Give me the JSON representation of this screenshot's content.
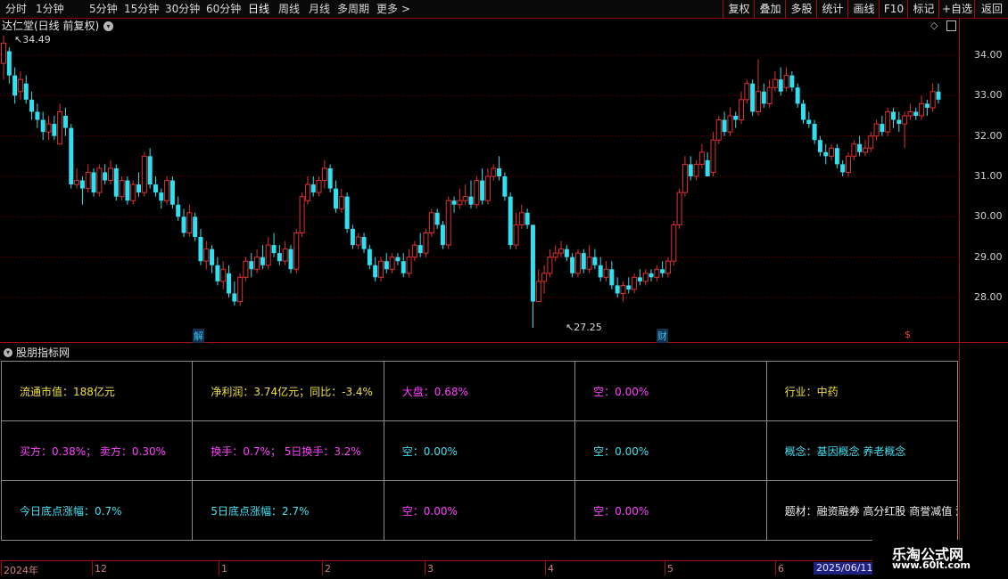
{
  "toolbar": {
    "periods": [
      "分时",
      "1分钟",
      "5分钟",
      "15分钟",
      "30分钟",
      "60分钟",
      "日线",
      "周线",
      "月线",
      "多周期",
      "更多 >"
    ],
    "right_buttons": [
      "复权",
      "叠加",
      "多股",
      "统计",
      "画线",
      "F10",
      "标记",
      "+自选",
      "返回"
    ]
  },
  "chart": {
    "title": "达仁堂(日线 前复权)",
    "high_label": "34.49",
    "low_label": "27.25",
    "markers": [
      "解",
      "财",
      "$"
    ],
    "colors": {
      "up": "#e03030",
      "down": "#30e0f0",
      "grid": "#7a0000"
    }
  },
  "chart_data": {
    "type": "candlestick",
    "y_ticks": [
      "34.00",
      "33.00",
      "32.00",
      "31.00",
      "30.00",
      "29.00",
      "28.00"
    ],
    "ylim": [
      27.2,
      34.6
    ],
    "x_ticks": [
      "2024年",
      "12",
      "1",
      "2",
      "3",
      "4",
      "5",
      "6"
    ],
    "candles": [
      [
        33.8,
        34.3,
        33.4,
        34.49
      ],
      [
        34.1,
        33.5,
        33.3,
        34.2
      ],
      [
        33.5,
        33.0,
        32.8,
        33.7
      ],
      [
        33.1,
        33.4,
        32.9,
        33.6
      ],
      [
        33.3,
        32.9,
        32.8,
        33.5
      ],
      [
        32.9,
        32.6,
        32.4,
        33.1
      ],
      [
        32.6,
        32.4,
        32.2,
        32.8
      ],
      [
        32.4,
        32.1,
        31.9,
        32.6
      ],
      [
        32.1,
        32.3,
        31.9,
        32.5
      ],
      [
        32.3,
        32.0,
        31.9,
        32.5
      ],
      [
        31.8,
        32.6,
        31.8,
        32.8
      ],
      [
        32.5,
        32.2,
        32.0,
        32.7
      ],
      [
        32.2,
        30.8,
        30.7,
        32.3
      ],
      [
        30.8,
        30.9,
        30.7,
        31.2
      ],
      [
        30.9,
        30.7,
        30.3,
        31.0
      ],
      [
        30.7,
        31.1,
        30.6,
        31.3
      ],
      [
        31.1,
        30.6,
        30.5,
        31.2
      ],
      [
        30.6,
        31.2,
        30.5,
        31.3
      ],
      [
        31.1,
        30.9,
        30.8,
        31.3
      ],
      [
        30.9,
        31.2,
        30.8,
        31.4
      ],
      [
        31.2,
        30.5,
        30.4,
        31.3
      ],
      [
        30.5,
        30.9,
        30.4,
        31.0
      ],
      [
        30.9,
        30.4,
        30.3,
        31.0
      ],
      [
        30.4,
        30.8,
        30.3,
        30.9
      ],
      [
        30.8,
        30.6,
        30.5,
        31.1
      ],
      [
        30.6,
        31.5,
        30.5,
        31.6
      ],
      [
        31.5,
        30.8,
        30.7,
        31.7
      ],
      [
        30.8,
        30.6,
        30.5,
        31.0
      ],
      [
        30.6,
        30.4,
        30.2,
        30.7
      ],
      [
        30.4,
        30.9,
        30.3,
        31.0
      ],
      [
        30.9,
        30.3,
        30.2,
        31.0
      ],
      [
        30.3,
        30.0,
        29.9,
        30.5
      ],
      [
        30.0,
        29.6,
        29.5,
        30.2
      ],
      [
        29.6,
        30.1,
        29.5,
        30.3
      ],
      [
        30.0,
        29.5,
        29.4,
        30.1
      ],
      [
        29.5,
        28.9,
        28.8,
        29.7
      ],
      [
        28.9,
        29.2,
        28.7,
        29.4
      ],
      [
        29.2,
        28.8,
        28.6,
        29.3
      ],
      [
        28.8,
        28.4,
        28.3,
        29.0
      ],
      [
        28.4,
        28.7,
        28.2,
        28.9
      ],
      [
        28.6,
        28.1,
        28.0,
        28.8
      ],
      [
        28.1,
        27.9,
        27.8,
        28.4
      ],
      [
        27.9,
        28.5,
        27.8,
        28.6
      ],
      [
        28.5,
        28.9,
        28.4,
        29.0
      ],
      [
        28.9,
        28.7,
        28.5,
        29.1
      ],
      [
        28.7,
        29.0,
        28.6,
        29.2
      ],
      [
        29.0,
        28.8,
        28.7,
        29.3
      ],
      [
        28.8,
        29.3,
        28.7,
        29.5
      ],
      [
        29.3,
        29.1,
        29.0,
        29.6
      ],
      [
        29.1,
        28.9,
        28.8,
        29.3
      ],
      [
        28.9,
        29.2,
        28.8,
        29.4
      ],
      [
        29.2,
        28.7,
        28.6,
        29.3
      ],
      [
        28.7,
        29.6,
        28.6,
        29.7
      ],
      [
        29.6,
        30.5,
        29.5,
        30.6
      ],
      [
        30.4,
        30.8,
        30.3,
        31.0
      ],
      [
        30.8,
        30.6,
        30.5,
        31.0
      ],
      [
        30.6,
        30.9,
        30.5,
        31.0
      ],
      [
        30.9,
        31.2,
        30.7,
        31.4
      ],
      [
        31.2,
        30.7,
        30.6,
        31.3
      ],
      [
        30.7,
        30.2,
        30.1,
        30.9
      ],
      [
        30.2,
        30.5,
        30.1,
        30.7
      ],
      [
        30.5,
        29.7,
        29.6,
        30.6
      ],
      [
        29.7,
        29.3,
        29.2,
        29.8
      ],
      [
        29.3,
        29.5,
        29.2,
        29.6
      ],
      [
        29.5,
        29.2,
        29.1,
        29.6
      ],
      [
        29.2,
        28.8,
        28.7,
        29.3
      ],
      [
        28.8,
        28.5,
        28.4,
        29.0
      ],
      [
        28.5,
        28.9,
        28.4,
        29.0
      ],
      [
        28.9,
        28.7,
        28.6,
        29.1
      ],
      [
        28.7,
        29.0,
        28.6,
        29.1
      ],
      [
        29.0,
        28.9,
        28.8,
        29.1
      ],
      [
        28.9,
        28.6,
        28.5,
        29.1
      ],
      [
        28.6,
        29.0,
        28.5,
        29.2
      ],
      [
        29.0,
        29.3,
        28.9,
        29.4
      ],
      [
        29.3,
        29.1,
        29.0,
        29.6
      ],
      [
        29.1,
        29.6,
        29.0,
        29.7
      ],
      [
        29.6,
        30.1,
        29.5,
        30.2
      ],
      [
        30.1,
        29.8,
        29.7,
        30.2
      ],
      [
        29.8,
        29.3,
        29.2,
        29.9
      ],
      [
        29.3,
        30.4,
        29.2,
        30.5
      ],
      [
        30.4,
        30.3,
        30.1,
        30.5
      ],
      [
        30.3,
        30.4,
        30.2,
        30.7
      ],
      [
        30.4,
        30.5,
        30.3,
        30.8
      ],
      [
        30.5,
        30.3,
        30.2,
        30.9
      ],
      [
        30.3,
        30.9,
        30.2,
        31.0
      ],
      [
        30.9,
        30.4,
        30.3,
        31.2
      ],
      [
        30.4,
        31.0,
        30.3,
        31.2
      ],
      [
        31.0,
        31.2,
        30.9,
        31.3
      ],
      [
        31.2,
        31.0,
        30.9,
        31.5
      ],
      [
        31.0,
        30.5,
        30.4,
        31.1
      ],
      [
        30.5,
        29.3,
        29.2,
        30.6
      ],
      [
        29.3,
        29.8,
        29.2,
        30.1
      ],
      [
        29.8,
        30.1,
        29.7,
        30.3
      ],
      [
        30.1,
        29.8,
        29.7,
        30.2
      ],
      [
        29.8,
        27.9,
        27.25,
        28.9
      ],
      [
        27.9,
        28.4,
        27.9,
        28.7
      ],
      [
        28.4,
        28.6,
        28.1,
        28.8
      ],
      [
        28.6,
        29.0,
        28.5,
        29.2
      ],
      [
        29.0,
        29.1,
        28.9,
        29.3
      ],
      [
        29.1,
        29.2,
        29.0,
        29.4
      ],
      [
        29.2,
        29.0,
        28.9,
        29.3
      ],
      [
        29.0,
        28.6,
        28.5,
        29.1
      ],
      [
        28.6,
        29.1,
        28.5,
        29.2
      ],
      [
        29.1,
        28.7,
        28.6,
        29.2
      ],
      [
        28.7,
        29.0,
        28.6,
        29.3
      ],
      [
        29.0,
        28.8,
        28.7,
        29.2
      ],
      [
        28.8,
        28.5,
        28.4,
        29.0
      ],
      [
        28.5,
        28.7,
        28.4,
        28.9
      ],
      [
        28.7,
        28.3,
        28.2,
        28.9
      ],
      [
        28.3,
        28.1,
        28.0,
        28.5
      ],
      [
        28.1,
        28.3,
        27.9,
        28.4
      ],
      [
        28.3,
        28.2,
        28.1,
        28.5
      ],
      [
        28.2,
        28.5,
        28.1,
        28.6
      ],
      [
        28.5,
        28.4,
        28.3,
        28.7
      ],
      [
        28.4,
        28.6,
        28.3,
        28.7
      ],
      [
        28.6,
        28.5,
        28.4,
        28.7
      ],
      [
        28.5,
        28.7,
        28.4,
        28.8
      ],
      [
        28.7,
        28.6,
        28.5,
        28.9
      ],
      [
        28.6,
        28.9,
        28.5,
        29.0
      ],
      [
        28.9,
        29.8,
        28.8,
        29.9
      ],
      [
        29.8,
        30.6,
        29.7,
        30.7
      ],
      [
        30.6,
        31.3,
        30.5,
        31.5
      ],
      [
        31.3,
        31.0,
        30.9,
        31.5
      ],
      [
        31.0,
        31.3,
        30.9,
        31.4
      ],
      [
        31.3,
        31.6,
        31.2,
        31.8
      ],
      [
        31.4,
        31.0,
        31.0,
        31.6
      ],
      [
        31.1,
        31.9,
        31.0,
        32.1
      ],
      [
        31.9,
        32.4,
        31.8,
        32.5
      ],
      [
        32.4,
        32.1,
        32.0,
        32.6
      ],
      [
        32.1,
        32.5,
        32.0,
        32.7
      ],
      [
        32.5,
        32.4,
        32.2,
        32.6
      ],
      [
        32.4,
        32.9,
        32.3,
        33.1
      ],
      [
        32.9,
        33.3,
        32.8,
        33.4
      ],
      [
        33.3,
        32.6,
        32.5,
        33.4
      ],
      [
        32.6,
        33.1,
        32.5,
        33.9
      ],
      [
        33.1,
        32.8,
        32.7,
        33.3
      ],
      [
        32.8,
        33.2,
        32.7,
        33.4
      ],
      [
        33.2,
        33.4,
        33.1,
        33.6
      ],
      [
        33.4,
        33.1,
        33.0,
        33.7
      ],
      [
        33.2,
        33.5,
        33.1,
        33.7
      ],
      [
        33.5,
        33.2,
        33.1,
        33.6
      ],
      [
        33.2,
        32.8,
        32.7,
        33.3
      ],
      [
        32.8,
        32.4,
        32.3,
        32.9
      ],
      [
        32.4,
        32.3,
        32.2,
        32.6
      ],
      [
        32.3,
        31.9,
        31.8,
        32.4
      ],
      [
        31.9,
        31.6,
        31.5,
        32.0
      ],
      [
        31.6,
        31.5,
        31.3,
        31.8
      ],
      [
        31.5,
        31.7,
        31.4,
        31.8
      ],
      [
        31.7,
        31.3,
        31.2,
        31.8
      ],
      [
        31.3,
        31.1,
        31.0,
        31.4
      ],
      [
        31.1,
        31.5,
        31.0,
        31.6
      ],
      [
        31.5,
        31.8,
        31.4,
        31.9
      ],
      [
        31.8,
        31.6,
        31.5,
        32.0
      ],
      [
        31.6,
        31.7,
        31.5,
        31.9
      ],
      [
        31.7,
        32.0,
        31.6,
        32.1
      ],
      [
        32.0,
        32.3,
        31.9,
        32.4
      ],
      [
        32.3,
        32.1,
        32.0,
        32.5
      ],
      [
        32.1,
        32.6,
        32.0,
        32.7
      ],
      [
        32.6,
        32.4,
        32.2,
        32.7
      ],
      [
        32.4,
        32.3,
        32.1,
        32.6
      ],
      [
        32.3,
        32.5,
        31.7,
        32.6
      ],
      [
        32.5,
        32.6,
        32.4,
        32.8
      ],
      [
        32.6,
        32.5,
        32.4,
        32.7
      ],
      [
        32.5,
        32.8,
        32.4,
        33.0
      ],
      [
        32.8,
        32.7,
        32.5,
        32.9
      ],
      [
        32.7,
        33.1,
        32.6,
        33.3
      ],
      [
        33.1,
        32.9,
        32.8,
        33.3
      ]
    ]
  },
  "panel": {
    "title": "股朋指标网",
    "rows": [
      [
        [
          "流通市值：188亿元",
          "yellow"
        ],
        [
          "净利润：3.74亿元；同比：-3.4%",
          "yellow"
        ],
        [
          "大盘：0.68%",
          "magenta"
        ],
        [
          "空：0.00%",
          "magenta"
        ],
        [
          "行业：中药",
          "yellow"
        ]
      ],
      [
        [
          "买方：0.38%；  卖方：0.30%",
          "magenta"
        ],
        [
          "换手：0.7%；  5日换手：3.2%",
          "magenta"
        ],
        [
          "空：0.00%",
          "cyan"
        ],
        [
          "空：0.00%",
          "cyan"
        ],
        [
          "概念：基因概念 养老概念",
          "cyan"
        ]
      ],
      [
        [
          "今日底点涨幅：0.7%",
          "cyan"
        ],
        [
          "5日底点涨幅：2.7%",
          "cyan"
        ],
        [
          "空：0.00%",
          "magenta"
        ],
        [
          "空：0.00%",
          "magenta"
        ],
        [
          "题材：融资融券 高分红股 商誉减值 沪股通",
          "white"
        ]
      ]
    ]
  },
  "timeaxis": {
    "current_date": "2025/06/11/"
  },
  "watermark": {
    "name": "乐淘公式网",
    "url": "www.60lt.com"
  }
}
